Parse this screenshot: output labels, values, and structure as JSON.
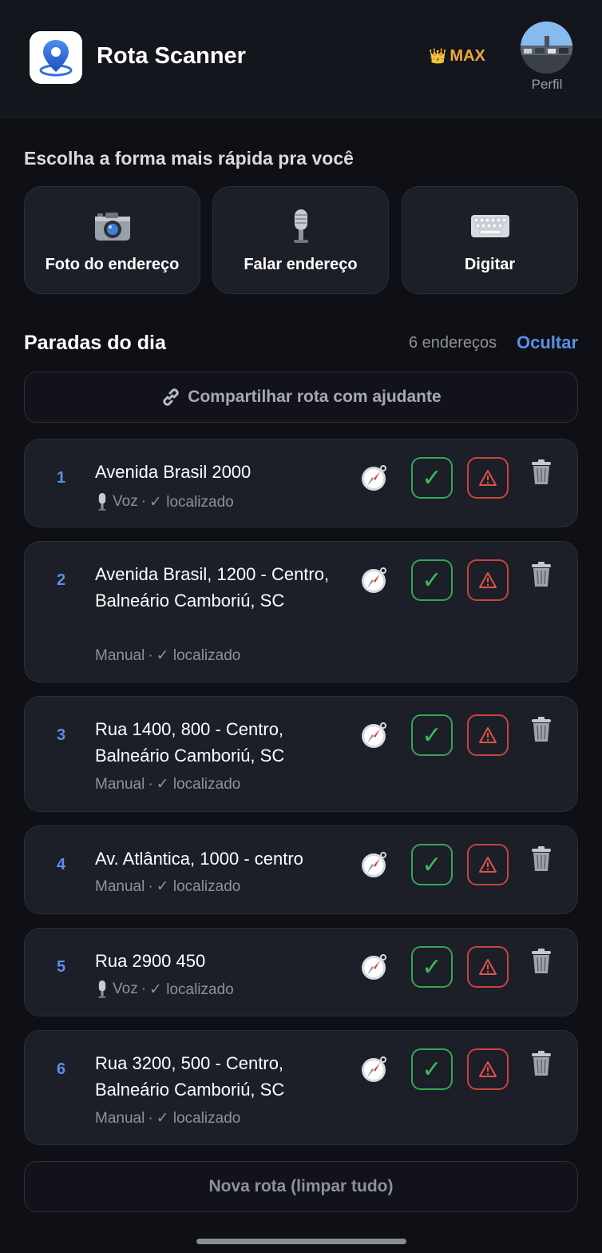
{
  "header": {
    "title": "Rota Scanner",
    "plan_label": "MAX",
    "plan_icon": "crown-icon",
    "profile_label": "Perfil"
  },
  "input_section": {
    "title": "Escolha a forma mais rápida pra você",
    "options": [
      {
        "label": "Foto do endereço",
        "icon": "camera-icon"
      },
      {
        "label": "Falar endereço",
        "icon": "microphone-icon"
      },
      {
        "label": "Digitar",
        "icon": "keyboard-icon"
      }
    ]
  },
  "stops": {
    "title": "Paradas do dia",
    "count_label": "6 endereços",
    "toggle_label": "Ocultar",
    "share_label": "Compartilhar rota com ajudante",
    "meta_separator": "·",
    "status_label": "✓ localizado",
    "items": [
      {
        "number": "1",
        "address": "Avenida Brasil 2000",
        "source": "Voz",
        "source_icon": "microphone-icon"
      },
      {
        "number": "2",
        "address": "Avenida Brasil, 1200 - Centro, Balneário Camboriú, SC",
        "source": "Manual",
        "source_icon": ""
      },
      {
        "number": "3",
        "address": "Rua 1400, 800 - Centro, Balneário Camboriú, SC",
        "source": "Manual",
        "source_icon": ""
      },
      {
        "number": "4",
        "address": "Av. Atlântica, 1000 - centro",
        "source": "Manual",
        "source_icon": ""
      },
      {
        "number": "5",
        "address": "Rua 2900 450",
        "source": "Voz",
        "source_icon": "microphone-icon"
      },
      {
        "number": "6",
        "address": "Rua 3200, 500 - Centro, Balneário Camboriú, SC",
        "source": "Manual",
        "source_icon": ""
      }
    ],
    "done_symbol": "✓"
  },
  "footer": {
    "clear_label": "Nova rota (limpar tudo)"
  },
  "colors": {
    "accent_blue": "#5b8fe6",
    "plan_gold": "#f2a93b",
    "success_green": "#34a853",
    "danger_red": "#c9443d",
    "card_bg": "#1c1e28",
    "page_bg": "#0f1015"
  }
}
